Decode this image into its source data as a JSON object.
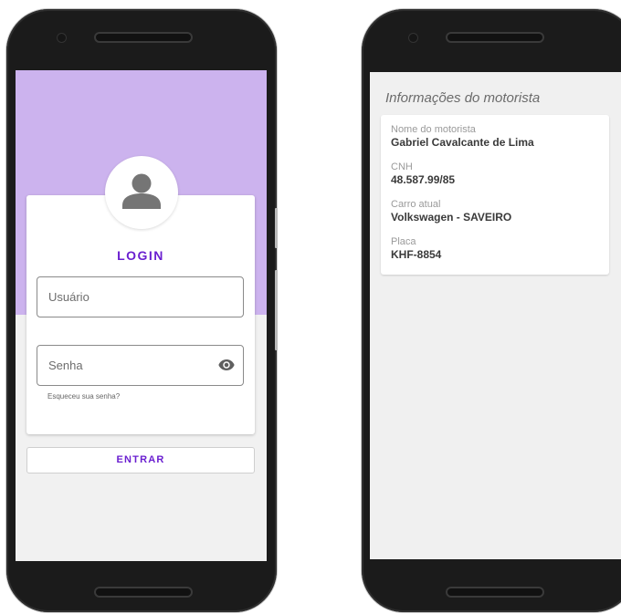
{
  "login_screen": {
    "title": "LOGIN",
    "avatar_icon": "person-icon",
    "username": {
      "value": "",
      "placeholder": "Usuário"
    },
    "password": {
      "value": "",
      "placeholder": "Senha",
      "toggle_icon": "eye-icon"
    },
    "forgot_password": "Esqueceu sua senha?",
    "submit_label": "ENTRAR"
  },
  "driver_screen": {
    "title": "Informações do motorista",
    "fields": [
      {
        "label": "Nome do motorista",
        "value": "Gabriel Cavalcante de Lima"
      },
      {
        "label": "CNH",
        "value": "48.587.99/85"
      },
      {
        "label": "Carro atual",
        "value": "Volkswagen - SAVEIRO"
      },
      {
        "label": "Placa",
        "value": "KHF-8854"
      }
    ]
  },
  "colors": {
    "accent": "#6a1fd0",
    "header_band": "#ccb3ee",
    "screen_background": "#f1f1f1",
    "device_body": "#1b1b1b"
  }
}
